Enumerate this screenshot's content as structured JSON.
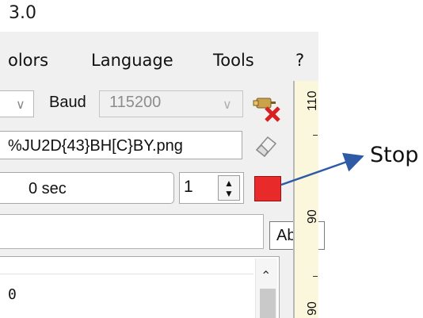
{
  "window": {
    "title_fragment": "3.0"
  },
  "menu": {
    "items": [
      "olors",
      "Language",
      "Tools",
      "?"
    ]
  },
  "toolbar": {
    "baud_label": "Baud",
    "baud_value": "115200",
    "filename": "%JU2D{43}BH[C}BY.png",
    "timer": "0 sec",
    "count": "1"
  },
  "tooltip": {
    "text": "Abo"
  },
  "list": {
    "value": "0"
  },
  "chart_strip": {
    "labels": [
      "110",
      "90",
      "90"
    ]
  },
  "annotation": {
    "label": "Stop",
    "arrow_color": "#2e5aa6"
  },
  "colors": {
    "stop_button": "#e82a2a",
    "chart_background": "#fbf7dc"
  },
  "icons": {
    "disconnect": "disconnect-icon",
    "eraser": "eraser-icon"
  }
}
